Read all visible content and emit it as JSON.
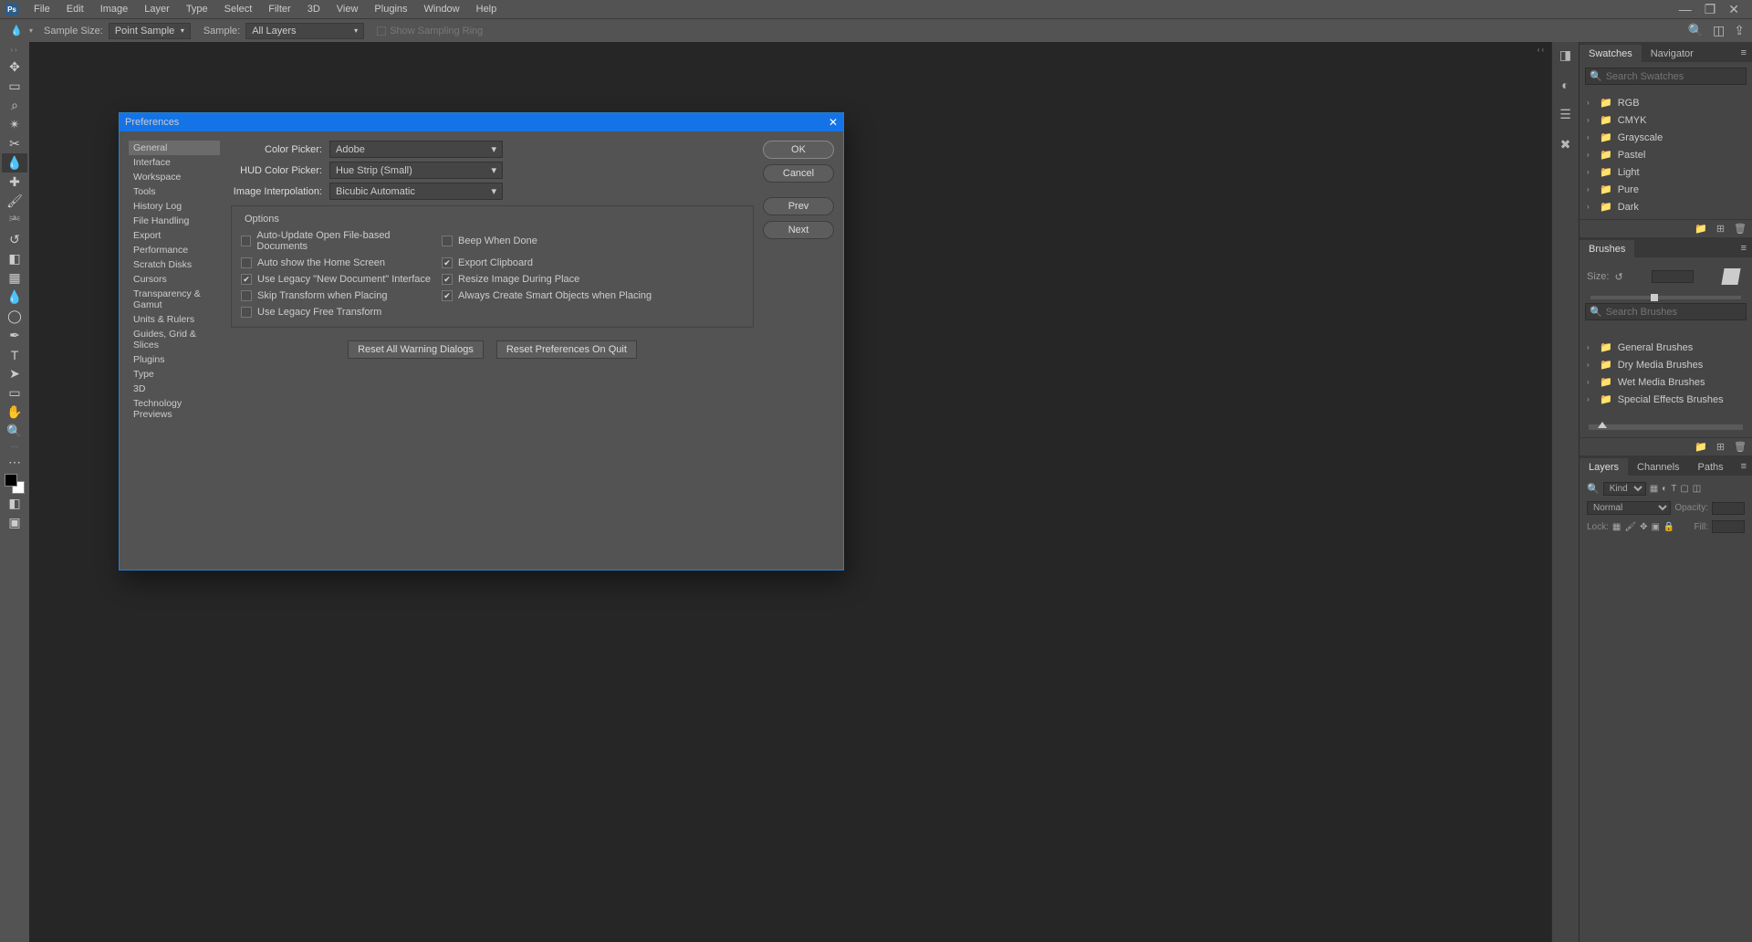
{
  "menubar": {
    "items": [
      "File",
      "Edit",
      "Image",
      "Layer",
      "Type",
      "Select",
      "Filter",
      "3D",
      "View",
      "Plugins",
      "Window",
      "Help"
    ],
    "logo": "Ps"
  },
  "optionsbar": {
    "sample_size_label": "Sample Size:",
    "sample_size_value": "Point Sample",
    "sample_label": "Sample:",
    "sample_value": "All Layers",
    "show_sampling_ring": "Show Sampling Ring"
  },
  "right_panels": {
    "swatches": {
      "tabs": [
        "Swatches",
        "Navigator"
      ],
      "active_tab": 0,
      "search_placeholder": "Search Swatches",
      "folders": [
        "RGB",
        "CMYK",
        "Grayscale",
        "Pastel",
        "Light",
        "Pure",
        "Dark"
      ]
    },
    "brushes": {
      "tabs": [
        "Brushes"
      ],
      "size_label": "Size:",
      "search_placeholder": "Search Brushes",
      "folders": [
        "General Brushes",
        "Dry Media Brushes",
        "Wet Media Brushes",
        "Special Effects Brushes"
      ]
    },
    "layers": {
      "tabs": [
        "Layers",
        "Channels",
        "Paths"
      ],
      "active_tab": 0,
      "filter_label": "Kind",
      "blend_mode": "Normal",
      "opacity_label": "Opacity:",
      "lock_label": "Lock:",
      "fill_label": "Fill:"
    }
  },
  "prefs": {
    "title": "Preferences",
    "categories": [
      "General",
      "Interface",
      "Workspace",
      "Tools",
      "History Log",
      "File Handling",
      "Export",
      "Performance",
      "Scratch Disks",
      "Cursors",
      "Transparency & Gamut",
      "Units & Rulers",
      "Guides, Grid & Slices",
      "Plugins",
      "Type",
      "3D",
      "Technology Previews"
    ],
    "active_category": 0,
    "rows": {
      "color_picker_label": "Color Picker:",
      "color_picker_value": "Adobe",
      "hud_label": "HUD Color Picker:",
      "hud_value": "Hue Strip (Small)",
      "interp_label": "Image Interpolation:",
      "interp_value": "Bicubic Automatic"
    },
    "options_legend": "Options",
    "checkboxes": [
      {
        "label": "Auto-Update Open File-based Documents",
        "checked": false
      },
      {
        "label": "Beep When Done",
        "checked": false
      },
      {
        "label": "Auto show the Home Screen",
        "checked": false
      },
      {
        "label": "Export Clipboard",
        "checked": true
      },
      {
        "label": "Use Legacy \"New Document\" Interface",
        "checked": true
      },
      {
        "label": "Resize Image During Place",
        "checked": true
      },
      {
        "label": "Skip Transform when Placing",
        "checked": false
      },
      {
        "label": "Always Create Smart Objects when Placing",
        "checked": true
      },
      {
        "label": "Use Legacy Free Transform",
        "checked": false
      }
    ],
    "buttons": {
      "reset_warnings": "Reset All Warning Dialogs",
      "reset_prefs": "Reset Preferences On Quit",
      "ok": "OK",
      "cancel": "Cancel",
      "prev": "Prev",
      "next": "Next"
    }
  }
}
